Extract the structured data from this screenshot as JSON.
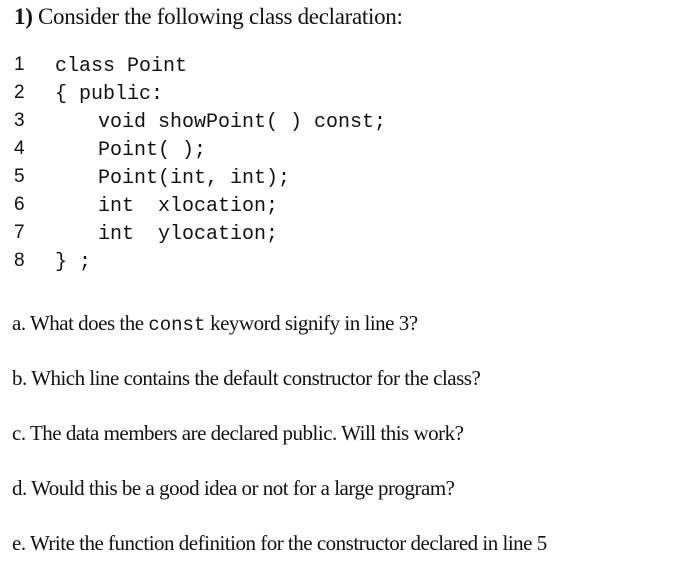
{
  "title": {
    "number": "1)",
    "text": " Consider the following class declaration:"
  },
  "code": {
    "lines": [
      {
        "number": "1",
        "text": "class Point",
        "indent": 0
      },
      {
        "number": "2",
        "text": "{ public:",
        "indent": 0
      },
      {
        "number": "3",
        "text": "void showPoint( ) const;",
        "indent": 1
      },
      {
        "number": "4",
        "text": "Point( );",
        "indent": 1
      },
      {
        "number": "5",
        "text": "Point(int, int);",
        "indent": 1
      },
      {
        "number": "6",
        "text": "int  xlocation;",
        "indent": 1
      },
      {
        "number": "7",
        "text": "int  ylocation;",
        "indent": 1
      },
      {
        "number": "8",
        "text": "} ;",
        "indent": 0
      }
    ]
  },
  "questions": {
    "a": {
      "before": "a. What does the ",
      "keyword": "const",
      "after": " keyword signify in line 3?"
    },
    "b": {
      "text": "b. Which line contains the default constructor for the class?"
    },
    "c": {
      "text": "c. The data members are declared public. Will this work?"
    },
    "d": {
      "text": "d. Would this be a good idea or not for a large program?"
    },
    "e": {
      "text": "e. Write the function definition for the constructor declared in line 5"
    }
  }
}
